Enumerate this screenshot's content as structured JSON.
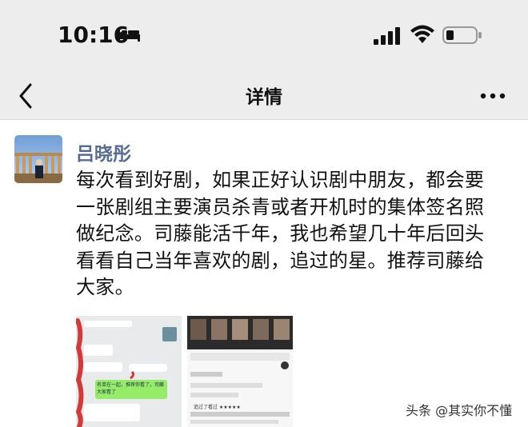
{
  "status_bar": {
    "time": "10:16",
    "icons": [
      "bed-icon",
      "signal-icon",
      "wifi-icon",
      "battery-icon"
    ]
  },
  "nav": {
    "back_icon": "chevron-left-icon",
    "title": "详情",
    "more_icon": "more-dots-icon"
  },
  "post": {
    "author": "吕晓彤",
    "lines": [
      "每次看到好剧，如果正好认识剧中朋友，都会要",
      "一张剧组主要演员杀青或者开机时的集体签名照",
      "做纪念。司藤能活千年，我也希望几十年后回头",
      "看看自己当年喜欢的剧，追过的星。推荐司藤给",
      "大家。"
    ],
    "images": [
      {
        "kind": "chat-screenshot",
        "visible_text": [
          "名单在一起，推荐你看了，司藤大家看了"
        ]
      },
      {
        "kind": "app-screenshot",
        "visible_text": [
          "追过了看过",
          "追过了看过 ★★★★★"
        ]
      }
    ]
  },
  "watermark": "头条 @其实你不懂",
  "colors": {
    "header_bg": "#ededed",
    "author": "#576b95",
    "text": "#111111",
    "bubble_green": "#95ec69"
  }
}
